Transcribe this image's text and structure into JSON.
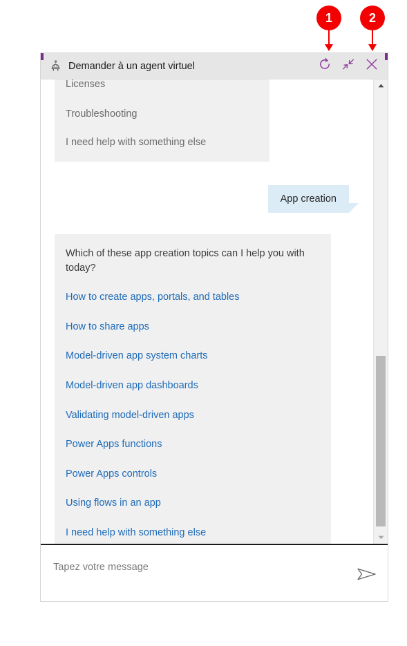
{
  "header": {
    "agent_icon": "robot-agent-icon",
    "title": "Demander à un agent virtuel",
    "restart_icon": "refresh-circle-icon",
    "restart_label": "Restart",
    "minimize_icon": "collapse-arrows-icon",
    "minimize_label": "Minimize",
    "close_icon": "close-x-icon",
    "close_label": "Close",
    "icon_color": "#7b2d8e",
    "background": "#e6e6e6"
  },
  "transcript": {
    "clipped_message": {
      "clipped_line": "Licenses",
      "options": [
        "Troubleshooting",
        "I need help with something else"
      ]
    },
    "user_message": {
      "text": "App creation",
      "bubble_color": "#dcecf7"
    },
    "topics_message": {
      "question": "Which of these app creation topics can I help you with today?",
      "links": [
        "How to create apps, portals, and tables",
        "How to share apps",
        "Model-driven app system charts",
        "Model-driven app dashboards",
        "Validating model-driven apps",
        "Power Apps functions",
        "Power Apps controls",
        "Using flows in an app",
        "I need help with something else"
      ],
      "bubble_color": "#f0f0f0",
      "link_color": "#1e6bb8"
    }
  },
  "scrollbar": {
    "up_arrow": "scroll-up-arrow-icon",
    "down_arrow": "scroll-down-arrow-icon"
  },
  "composer": {
    "placeholder": "Tapez votre message",
    "value": "",
    "send_icon": "send-paper-plane-icon",
    "send_label": "Send"
  },
  "annotations": {
    "badge_color": "#f30000",
    "items": [
      {
        "number": "1",
        "target": "restart-button"
      },
      {
        "number": "2",
        "target": "close-button"
      }
    ]
  }
}
